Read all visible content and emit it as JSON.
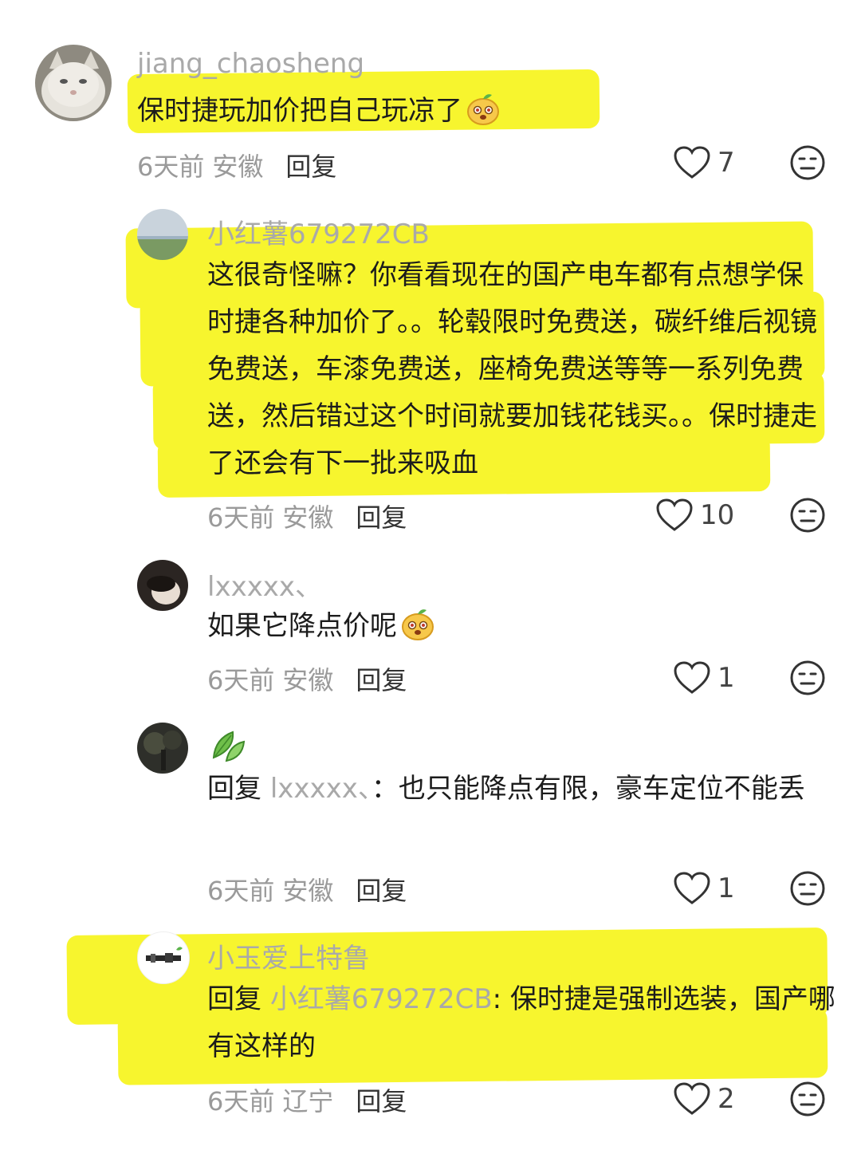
{
  "comments": [
    {
      "username": "jiang_chaosheng",
      "text": "保时捷玩加价把自己玩凉了",
      "emoji": "mango-emoji",
      "time": "6天前",
      "location": "安徽",
      "reply_label": "回复",
      "likes": "7"
    },
    {
      "username": "小红薯679272CB",
      "text": "这很奇怪嘛？你看看现在的国产电车都有点想学保时捷各种加价了。。轮毂限时免费送，碳纤维后视镜免费送，车漆免费送，座椅免费送等等一系列免费送，然后错过这个时间就要加钱花钱买。。保时捷走了还会有下一批来吸血",
      "time": "6天前",
      "location": "安徽",
      "reply_label": "回复",
      "likes": "10"
    },
    {
      "username": "lxxxxx、",
      "text": "如果它降点价呢",
      "emoji": "mango-emoji",
      "time": "6天前",
      "location": "安徽",
      "reply_label": "回复",
      "likes": "1"
    },
    {
      "username": "leaf-emoji",
      "reply_prefix": "回复",
      "reply_to": "lxxxxx、",
      "text": "：也只能降点有限，豪车定位不能丢",
      "time": "6天前",
      "location": "安徽",
      "reply_label": "回复",
      "likes": "1"
    },
    {
      "username": "小玉爱上特鲁",
      "reply_prefix": "回复",
      "reply_to": "小红薯679272CB",
      "text": ": 保时捷是强制选装，国产哪有这样的",
      "time": "6天前",
      "location": "辽宁",
      "reply_label": "回复",
      "likes": "2"
    }
  ],
  "colors": {
    "highlight": "#f7f52e",
    "username": "#a9a9a9",
    "text": "#1c1c1c",
    "meta": "#9a9a9a"
  },
  "icons": [
    "heart-outline-icon",
    "neutral-face-icon"
  ]
}
